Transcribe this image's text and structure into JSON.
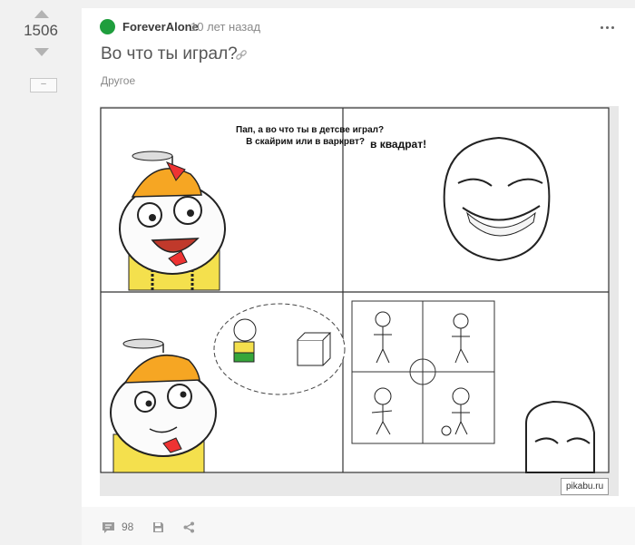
{
  "rating": {
    "score": "1506",
    "hide_label": "–"
  },
  "story": {
    "author": "ForeverAlone",
    "time": "10 лет назад",
    "title": "Во что ты играл?",
    "tag": "Другое"
  },
  "comic": {
    "panel1_line1": "Пап, а во что ты в детсве играл?",
    "panel1_line2": "В скайрим или в варкрвт?",
    "panel2_text": "в квадрат!",
    "watermark": "pikabu.ru"
  },
  "footer": {
    "comments_count": "98"
  },
  "colors": {
    "avatar": "#1f9e3d",
    "background": "#f1f1f1",
    "card": "#ffffff"
  },
  "icons": [
    "upvote-arrow-icon",
    "downvote-arrow-icon",
    "more-icon",
    "link-icon",
    "comments-icon",
    "save-icon",
    "share-icon"
  ]
}
